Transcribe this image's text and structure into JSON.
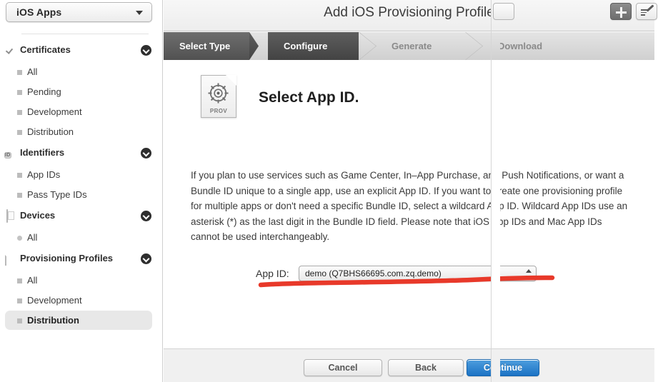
{
  "sidebar": {
    "account_selector": {
      "label": "iOS Apps",
      "icon": "chevron-down-icon"
    },
    "groups": [
      {
        "label": "Certificates",
        "icon": "certificate-badge-icon",
        "collapse_icon": "chevron-down-circle-icon",
        "items": [
          {
            "label": "All",
            "bullet": "square",
            "selected": false
          },
          {
            "label": "Pending",
            "bullet": "square",
            "selected": false
          },
          {
            "label": "Development",
            "bullet": "square",
            "selected": false
          },
          {
            "label": "Distribution",
            "bullet": "square",
            "selected": false
          }
        ]
      },
      {
        "label": "Identifiers",
        "icon": "id-card-icon",
        "icon_text": "ID",
        "collapse_icon": "chevron-down-circle-icon",
        "items": [
          {
            "label": "App IDs",
            "bullet": "square",
            "selected": false
          },
          {
            "label": "Pass Type IDs",
            "bullet": "square",
            "selected": false
          }
        ]
      },
      {
        "label": "Devices",
        "icon": "device-phone-icon",
        "collapse_icon": "chevron-down-circle-icon",
        "items": [
          {
            "label": "All",
            "bullet": "round",
            "selected": false
          }
        ]
      },
      {
        "label": "Provisioning Profiles",
        "icon": "document-icon",
        "collapse_icon": "chevron-down-circle-icon",
        "items": [
          {
            "label": "All",
            "bullet": "square",
            "selected": false
          },
          {
            "label": "Development",
            "bullet": "square",
            "selected": false
          },
          {
            "label": "Distribution",
            "bullet": "square",
            "selected": true
          }
        ]
      }
    ]
  },
  "titlebar": {
    "title": "Add iOS Provisioning Profile",
    "add_button": {
      "icon": "plus-icon",
      "label": ""
    },
    "edit_button": {
      "icon": "edit-pencil-icon",
      "label": ""
    }
  },
  "steps": [
    {
      "label": "Select Type",
      "state": "done"
    },
    {
      "label": "Configure",
      "state": "active"
    },
    {
      "label": "Generate",
      "state": "todo"
    },
    {
      "label": "Download",
      "state": "todo"
    }
  ],
  "main": {
    "icon": {
      "name": "provisioning-profile-icon",
      "caption": "PROV"
    },
    "heading": "Select App ID.",
    "paragraph": "If you plan to use services such as Game Center, In–App Purchase, and Push Notifications, or want a Bundle ID unique to a single app, use an explicit App ID. If you want to create one provisioning profile for multiple apps or don't need a specific Bundle ID, select a wildcard App ID. Wildcard App IDs use an asterisk (*) as the last digit in the Bundle ID field. Please note that iOS App IDs and Mac App IDs cannot be used interchangeably.",
    "app_id_field": {
      "label": "App ID:",
      "value": "demo (Q7BHS66695.com.zq.demo)",
      "stepper_icon": "stepper-updown-icon"
    },
    "annotation": {
      "name": "red-underline-annotation",
      "color": "#e8392a"
    }
  },
  "footer": {
    "cancel_label": "Cancel",
    "back_label": "Back",
    "continue_label": "Continue"
  },
  "colors": {
    "accent_blue": "#1b72c4",
    "annotation_red": "#e8392a",
    "step_active": "#434343",
    "sidebar_selected": "#e8e8e8"
  }
}
